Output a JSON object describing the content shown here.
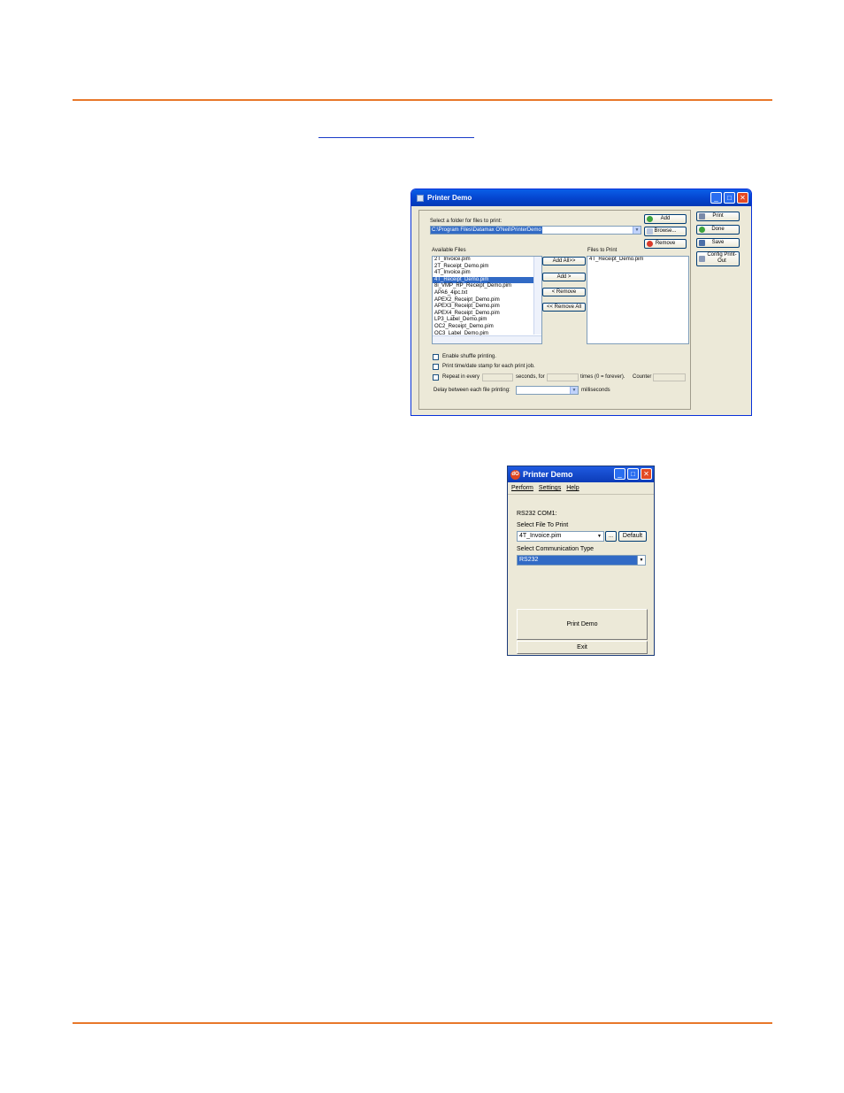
{
  "window_desktop": {
    "title": "Printer Demo",
    "folder_label": "Select a folder for files to print:",
    "folder_value": "C:\\Program Files\\Datamax O'Neil\\PrinterDemo",
    "add": "Add",
    "browse": "Browse...",
    "remove": "Remove",
    "available_label": "Available Files",
    "files_to_print_label": "Files to Print",
    "available_files": [
      "2T_Invoice.pim",
      "2T_Receipt_Demo.pim",
      "4T_Invoice.pim",
      "4T_Receipt_Demo.pim",
      "8i_VMP_RP_Receipt_Demo.pim",
      "APA6_4ipc.txt",
      "APEX2_Receipt_Demo.pim",
      "APEX3_Receipt_Demo.pim",
      "APEX4_Receipt_Demo.pim",
      "LP3_Label_Demo.pim",
      "OC2_Receipt_Demo.pim",
      "OC3_Label_Demo.pim"
    ],
    "selected_available_index": 3,
    "files_to_print": [
      "4T_Receipt_Demo.pim"
    ],
    "add_all": "Add All>>",
    "add_one": "Add >",
    "remove_one": "< Remove",
    "remove_all": "<< Remove All",
    "print": "Print",
    "done": "Done",
    "save": "Save",
    "config": "Config Print-Out",
    "shuffle": "Enable shuffle printing.",
    "timestamp": "Print time/date stamp for each print job.",
    "repeat": "Repeat in every",
    "seconds_for": "seconds, for",
    "times": "times (0 = forever).",
    "counter": "Counter",
    "delay": "Delay between each file printing:",
    "milliseconds": "milliseconds"
  },
  "window_mobile": {
    "title": "Printer Demo",
    "logo": "dO",
    "menu": [
      "Perform",
      "Settings",
      "Help"
    ],
    "status": "RS232 COM1:",
    "select_file_label": "Select File To Print",
    "select_file_value": "4T_Invoice.pim",
    "browse": "...",
    "default": "Default",
    "comm_label": "Select Communication Type",
    "comm_value": "RS232",
    "print_demo": "Print Demo",
    "exit": "Exit"
  },
  "colors": {
    "rule": "#e8782a",
    "selection": "#316ac5",
    "titlebar": "#0546d0"
  }
}
